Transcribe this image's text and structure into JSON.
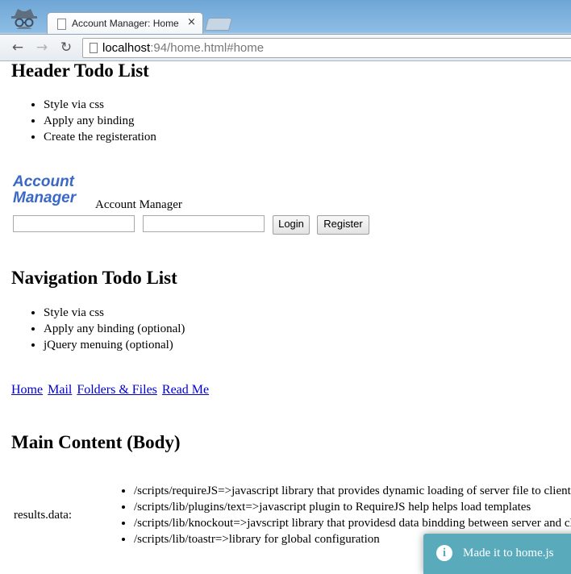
{
  "browser": {
    "tab_title": "Account Manager: Home",
    "tab_close": "×",
    "url_host": "localhost",
    "url_rest": ":94/home.html#home",
    "back_glyph": "←",
    "forward_glyph": "→",
    "reload_glyph": "↻"
  },
  "header": {
    "title": "Header Todo List",
    "items": [
      "Style via css",
      "Apply any binding",
      "Create the registeration"
    ]
  },
  "account": {
    "logo_line1": "Account",
    "logo_line2": "Manager",
    "logo_color": "#3a68c8",
    "label": "Account Manager",
    "login_label": "Login",
    "register_label": "Register"
  },
  "navigation": {
    "title": "Navigation Todo List",
    "items": [
      "Style via css",
      "Apply any binding (optional)",
      "jQuery menuing (optional)"
    ],
    "links": [
      "Home",
      "Mail",
      "Folders & Files",
      "Read Me"
    ]
  },
  "main": {
    "title": "Main Content (Body)",
    "results_label": "results.data:",
    "results": [
      "/scripts/requireJS=>javascript library that provides dynamic loading of server file to client",
      "/scripts/lib/plugins/text=>javascript plugin to RequireJS help helps load templates",
      "/scripts/lib/knockout=>javscript library that providesd data bindding between server and client",
      "/scripts/lib/toastr=>library for global configuration"
    ]
  },
  "toast": {
    "icon": "i",
    "message": "Made it to home.js",
    "color": "#51a7b8"
  }
}
